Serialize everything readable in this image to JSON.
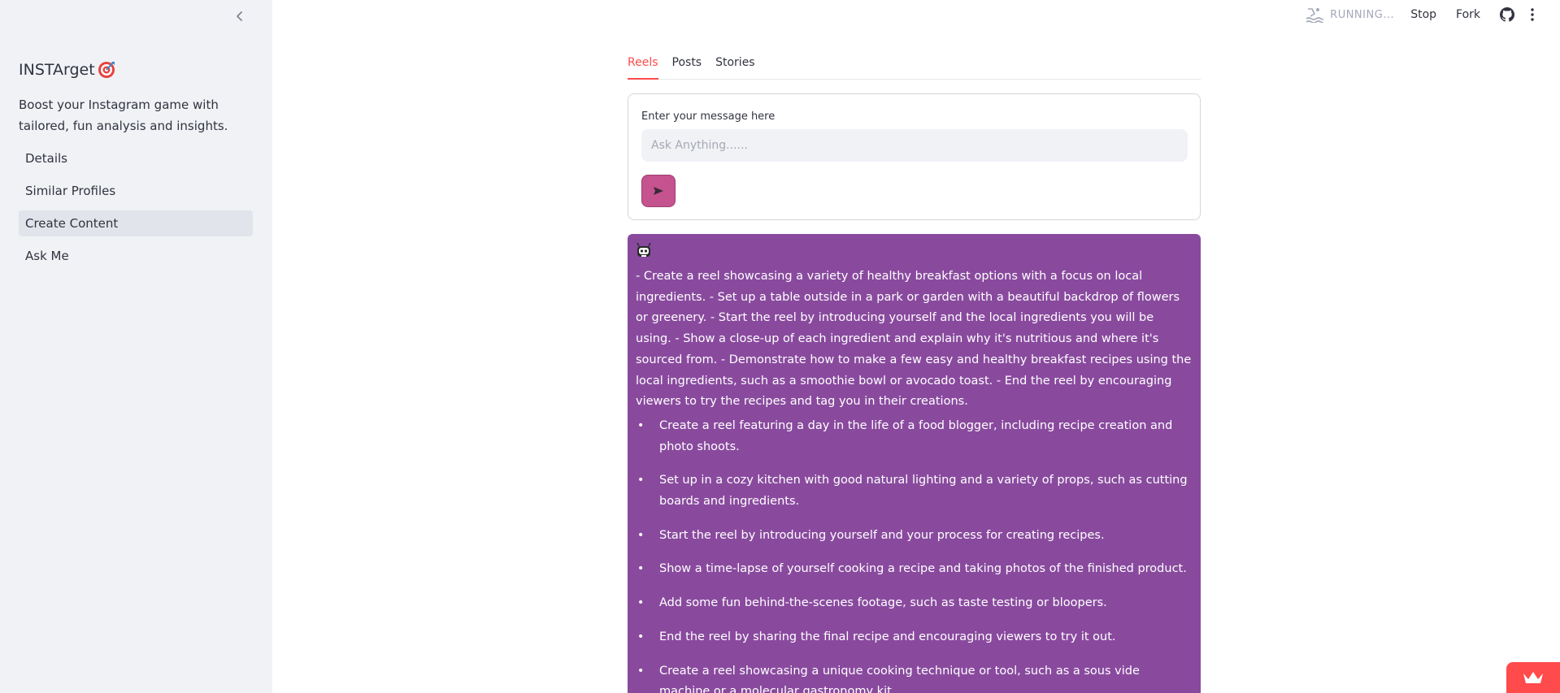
{
  "sidebar": {
    "title": "INSTArget",
    "description": "Boost your Instagram game with tailored, fun analysis and insights.",
    "nav": [
      {
        "label": "Details"
      },
      {
        "label": "Similar Profiles"
      },
      {
        "label": "Create Content",
        "active": true
      },
      {
        "label": "Ask Me"
      }
    ]
  },
  "toolbar": {
    "status": "RUNNING...",
    "stop_label": "Stop",
    "fork_label": "Fork",
    "icons": [
      "running-icon",
      "github-icon",
      "more-menu-icon"
    ]
  },
  "tabs": [
    {
      "label": "Reels",
      "active": true
    },
    {
      "label": "Posts"
    },
    {
      "label": "Stories"
    }
  ],
  "form": {
    "label": "Enter your message here",
    "placeholder": "Ask Anything......",
    "value": ""
  },
  "response": {
    "paragraph": "- Create a reel showcasing a variety of healthy breakfast options with a focus on local ingredients. - Set up a table outside in a park or garden with a beautiful backdrop of flowers or greenery. - Start the reel by introducing yourself and the local ingredients you will be using. - Show a close-up of each ingredient and explain why it's nutritious and where it's sourced from. - Demonstrate how to make a few easy and healthy breakfast recipes using the local ingredients, such as a smoothie bowl or avocado toast. - End the reel by encouraging viewers to try the recipes and tag you in their creations.",
    "bullets": [
      "Create a reel featuring a day in the life of a food blogger, including recipe creation and photo shoots.",
      "Set up in a cozy kitchen with good natural lighting and a variety of props, such as cutting boards and ingredients.",
      "Start the reel by introducing yourself and your process for creating recipes.",
      "Show a time-lapse of yourself cooking a recipe and taking photos of the finished product.",
      "Add some fun behind-the-scenes footage, such as taste testing or bloopers.",
      "End the reel by sharing the final recipe and encouraging viewers to try it out.",
      "Create a reel showcasing a unique cooking technique or tool, such as a sous vide machine or a molecular gastronomy kit."
    ]
  },
  "colors": {
    "accent": "#ff4b4b",
    "sidebar_bg": "#f0f2f6",
    "response_bg": "#894a9e",
    "send_button": "#c5538f"
  }
}
